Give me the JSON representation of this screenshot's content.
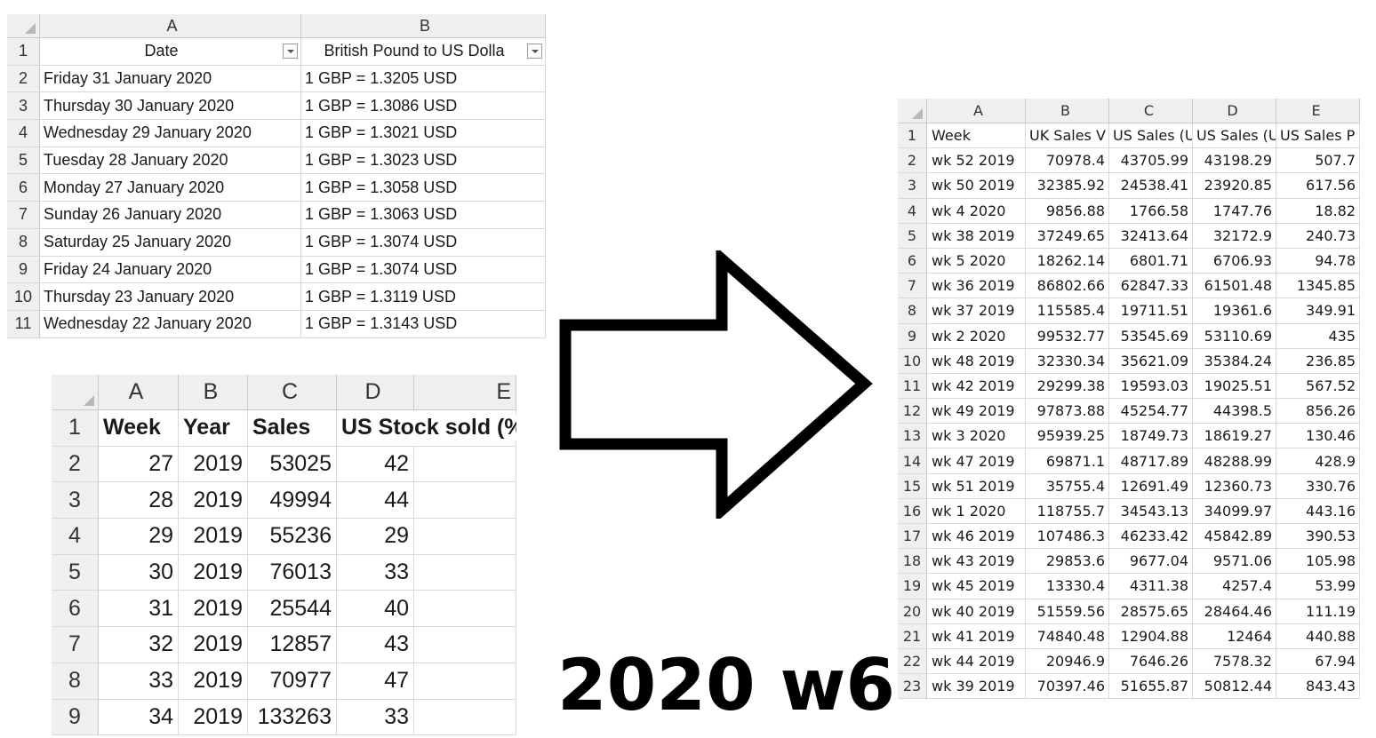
{
  "sheet1": {
    "col_headers": [
      "A",
      "B"
    ],
    "row_numbers": [
      "1",
      "2",
      "3",
      "4",
      "5",
      "6",
      "7",
      "8",
      "9",
      "10",
      "11"
    ],
    "header": [
      "Date",
      "British Pound to US Dolla"
    ],
    "rows": [
      [
        "Friday 31 January 2020",
        "1 GBP = 1.3205 USD"
      ],
      [
        "Thursday 30 January 2020",
        "1 GBP = 1.3086 USD"
      ],
      [
        "Wednesday 29 January 2020",
        "1 GBP = 1.3021 USD"
      ],
      [
        "Tuesday 28 January 2020",
        "1 GBP = 1.3023 USD"
      ],
      [
        "Monday 27 January 2020",
        "1 GBP = 1.3058 USD"
      ],
      [
        "Sunday 26 January 2020",
        "1 GBP = 1.3063 USD"
      ],
      [
        "Saturday 25 January 2020",
        "1 GBP = 1.3074 USD"
      ],
      [
        "Friday 24 January 2020",
        "1 GBP = 1.3074 USD"
      ],
      [
        "Thursday 23 January 2020",
        "1 GBP = 1.3119 USD"
      ],
      [
        "Wednesday 22 January 2020",
        "1 GBP = 1.3143 USD"
      ]
    ]
  },
  "sheet2": {
    "col_headers": [
      "A",
      "B",
      "C",
      "D",
      "E"
    ],
    "row_numbers": [
      "1",
      "2",
      "3",
      "4",
      "5",
      "6",
      "7",
      "8",
      "9"
    ],
    "header": [
      "Week",
      "Year",
      "Sales",
      "US Stock sold (%)",
      ""
    ],
    "rows": [
      [
        "27",
        "2019",
        "53025",
        "42"
      ],
      [
        "28",
        "2019",
        "49994",
        "44"
      ],
      [
        "29",
        "2019",
        "55236",
        "29"
      ],
      [
        "30",
        "2019",
        "76013",
        "33"
      ],
      [
        "31",
        "2019",
        "25544",
        "40"
      ],
      [
        "32",
        "2019",
        "12857",
        "43"
      ],
      [
        "33",
        "2019",
        "70977",
        "47"
      ],
      [
        "34",
        "2019",
        "133263",
        "33"
      ]
    ]
  },
  "sheet3": {
    "col_headers": [
      "A",
      "B",
      "C",
      "D",
      "E"
    ],
    "row_numbers": [
      "1",
      "2",
      "3",
      "4",
      "5",
      "6",
      "7",
      "8",
      "9",
      "10",
      "11",
      "12",
      "13",
      "14",
      "15",
      "16",
      "17",
      "18",
      "19",
      "20",
      "21",
      "22",
      "23"
    ],
    "header": [
      "Week",
      "UK Sales V",
      "US Sales (U",
      "US Sales (U",
      "US Sales P"
    ],
    "rows": [
      [
        "wk 52 2019",
        "70978.4",
        "43705.99",
        "43198.29",
        "507.7"
      ],
      [
        "wk 50 2019",
        "32385.92",
        "24538.41",
        "23920.85",
        "617.56"
      ],
      [
        "wk 4 2020",
        "9856.88",
        "1766.58",
        "1747.76",
        "18.82"
      ],
      [
        "wk 38 2019",
        "37249.65",
        "32413.64",
        "32172.9",
        "240.73"
      ],
      [
        "wk 5 2020",
        "18262.14",
        "6801.71",
        "6706.93",
        "94.78"
      ],
      [
        "wk 36 2019",
        "86802.66",
        "62847.33",
        "61501.48",
        "1345.85"
      ],
      [
        "wk 37 2019",
        "115585.4",
        "19711.51",
        "19361.6",
        "349.91"
      ],
      [
        "wk 2 2020",
        "99532.77",
        "53545.69",
        "53110.69",
        "435"
      ],
      [
        "wk 48 2019",
        "32330.34",
        "35621.09",
        "35384.24",
        "236.85"
      ],
      [
        "wk 42 2019",
        "29299.38",
        "19593.03",
        "19025.51",
        "567.52"
      ],
      [
        "wk 49 2019",
        "97873.88",
        "45254.77",
        "44398.5",
        "856.26"
      ],
      [
        "wk 3 2020",
        "95939.25",
        "18749.73",
        "18619.27",
        "130.46"
      ],
      [
        "wk 47 2019",
        "69871.1",
        "48717.89",
        "48288.99",
        "428.9"
      ],
      [
        "wk 51 2019",
        "35755.4",
        "12691.49",
        "12360.73",
        "330.76"
      ],
      [
        "wk 1 2020",
        "118755.7",
        "34543.13",
        "34099.97",
        "443.16"
      ],
      [
        "wk 46 2019",
        "107486.3",
        "46233.42",
        "45842.89",
        "390.53"
      ],
      [
        "wk 43 2019",
        "29853.6",
        "9677.04",
        "9571.06",
        "105.98"
      ],
      [
        "wk 45 2019",
        "13330.4",
        "4311.38",
        "4257.4",
        "53.99"
      ],
      [
        "wk 40 2019",
        "51559.56",
        "28575.65",
        "28464.46",
        "111.19"
      ],
      [
        "wk 41 2019",
        "74840.48",
        "12904.88",
        "12464",
        "440.88"
      ],
      [
        "wk 44 2019",
        "20946.9",
        "7646.26",
        "7578.32",
        "67.94"
      ],
      [
        "wk 39 2019",
        "70397.46",
        "51655.87",
        "50812.44",
        "843.43"
      ]
    ]
  },
  "caption": "2020 w6",
  "icons": {
    "arrow": "right-arrow-icon",
    "filter": "dropdown-filter-icon"
  }
}
